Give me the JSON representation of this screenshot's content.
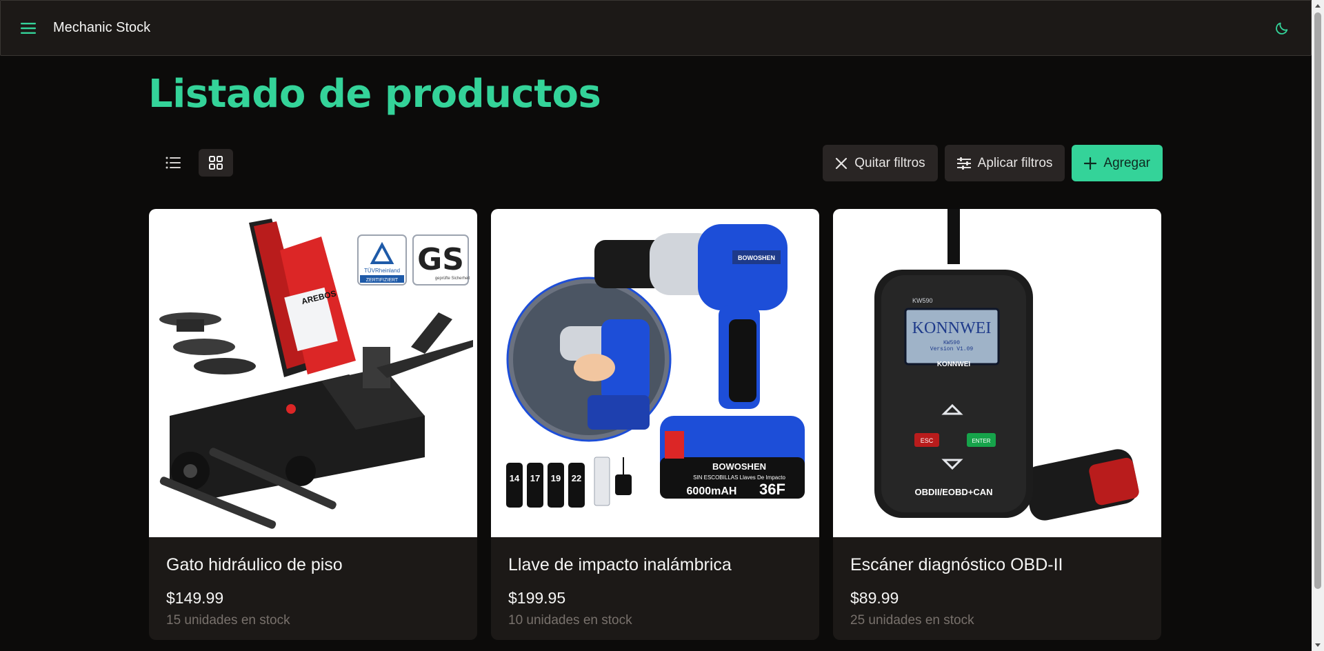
{
  "app": {
    "title": "Mechanic Stock",
    "accent_color": "#34d399",
    "icons": {
      "menu": "hamburger-icon",
      "theme": "moon-icon"
    }
  },
  "page": {
    "title": "Listado de productos"
  },
  "view_toggle": {
    "options": [
      {
        "name": "list",
        "icon": "list-icon",
        "active": false
      },
      {
        "name": "grid",
        "icon": "grid-icon",
        "active": true
      }
    ]
  },
  "actions": {
    "clear_filters_label": "Quitar filtros",
    "apply_filters_label": "Aplicar filtros",
    "add_label": "Agregar"
  },
  "products": [
    {
      "name": "Gato hidráulico de piso",
      "price": "$149.99",
      "stock": "15 unidades en stock",
      "image_text": {
        "brand": "AREBOS",
        "badge1": "TÜVRheinland",
        "badge1_sub": "ZERTIFIZIERT",
        "badge2": "GS",
        "badge2_sub": "geprüfte Sicherheit"
      }
    },
    {
      "name": "Llave de impacto inalámbrica",
      "price": "$199.95",
      "stock": "10 unidades en stock",
      "image_text": {
        "brand": "BOWOSHEN",
        "battery_line1": "BOWOSHEN",
        "battery_line2": "SIN ESCOBILLAS Llaves De Impacto",
        "battery_capacity": "6000mAH",
        "battery_model": "36F",
        "sockets": [
          "14",
          "17",
          "19",
          "22"
        ]
      }
    },
    {
      "name": "Escáner diagnóstico OBD-II",
      "price": "$89.99",
      "stock": "25 unidades en stock",
      "image_text": {
        "model": "KW590",
        "screen_brand": "KONNWEI",
        "screen_model": "KW590",
        "screen_version": "Version V1.09",
        "logo": "KONNWEI",
        "esc": "ESC",
        "enter": "ENTER",
        "protocols": "OBDII/EOBD+CAN"
      }
    }
  ]
}
